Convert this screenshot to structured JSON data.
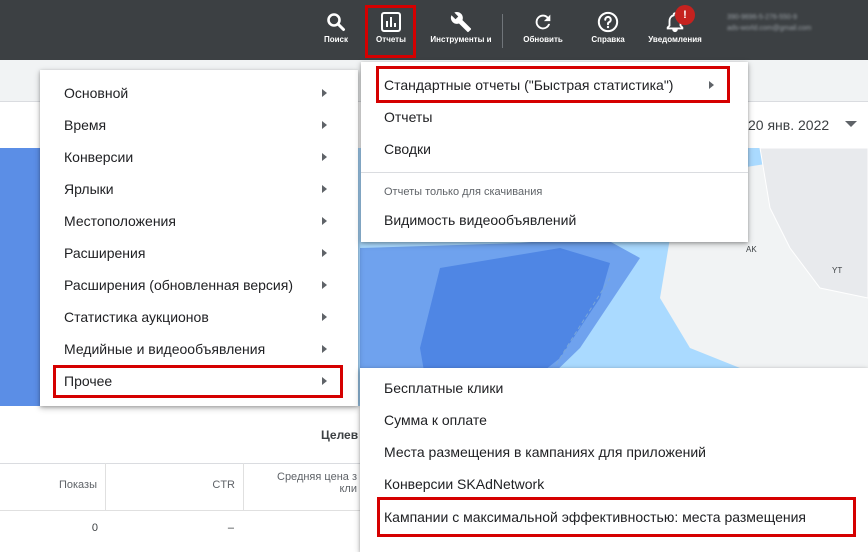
{
  "topbar": {
    "search_label": "Поиск",
    "reports_label": "Отчеты",
    "tools_label": "Инструменты и",
    "refresh_label": "Обновить",
    "help_label": "Справка",
    "notifications_label": "Уведомления",
    "notifications_badge": "!",
    "account_line1": "390-9696-5-276-550-9",
    "account_line2": "ads-world.com@gmail.com"
  },
  "date_range": {
    "text": "20 янв. 2022"
  },
  "map": {
    "label_ak": "AK",
    "label_yt": "YT"
  },
  "table": {
    "group_title": "Целев",
    "headers": [
      "Показы",
      "CTR",
      "Средняя цена з",
      "кли"
    ],
    "row": [
      "0",
      "–"
    ]
  },
  "left_menu": {
    "items": [
      "Основной",
      "Время",
      "Конверсии",
      "Ярлыки",
      "Местоположения",
      "Расширения",
      "Расширения (обновленная версия)",
      "Статистика аукционов",
      "Медийные и видеообъявления",
      "Прочее"
    ]
  },
  "reports_menu": {
    "items": [
      "Стандартные отчеты (\"Быстрая статистика\")",
      "Отчеты",
      "Сводки"
    ],
    "download_header": "Отчеты только для скачивания",
    "download_item": "Видимость видеообъявлений"
  },
  "other_menu": {
    "items": [
      "Бесплатные клики",
      "Сумма к оплате",
      "Места размещения в кампаниях для приложений",
      "Конверсии SKAdNetwork",
      "Кампании с максимальной эффективностью: места размещения"
    ]
  },
  "colors": {
    "topbar": "#3c4043",
    "highlight": "#d50000",
    "map_water": "#aadaff",
    "map_land_blue": "#5b8ee6"
  }
}
